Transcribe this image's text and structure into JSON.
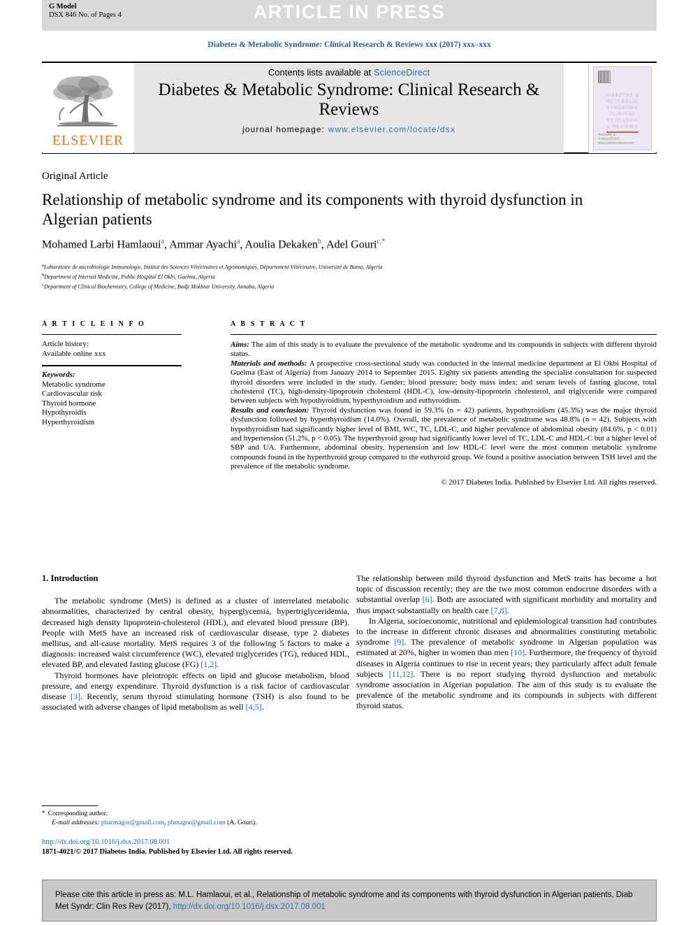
{
  "header": {
    "g_model": "G Model",
    "doc_id": "DSX 846 No. of Pages 4",
    "article_in_press": "ARTICLE IN PRESS",
    "journal_ref": "Diabetes & Metabolic Syndrome: Clinical Research & Reviews xxx (2017) xxx–xxx"
  },
  "masthead": {
    "contents_prefix": "Contents lists available at ",
    "sciencedirect": "ScienceDirect",
    "journal_title": "Diabetes & Metabolic Syndrome: Clinical Research & Reviews",
    "homepage_label": "journal homepage: ",
    "homepage_url": "www.elsevier.com/locate/dsx",
    "publisher": "ELSEVIER",
    "cover_line1": "DIABETES &",
    "cover_line2": "METABOLIC",
    "cover_line3": "SYNDROME",
    "cover_line4": "CLINICAL",
    "cover_line5": "RESEARCH",
    "cover_line6": "& REVIEWS",
    "cover_foot1": "Available at",
    "cover_foot2": "ScienceDirect",
    "cover_foot3": "www.sciencedirect.com"
  },
  "article": {
    "section_type": "Original Article",
    "title": "Relationship of metabolic syndrome and its components with thyroid dysfunction in Algerian patients",
    "authors": [
      {
        "name": "Mohamed Larbi Hamlaoui",
        "sup": "a",
        "sep": ", "
      },
      {
        "name": "Ammar Ayachi",
        "sup": "a",
        "sep": ", "
      },
      {
        "name": "Aoulia Dekaken",
        "sup": "b",
        "sep": ", "
      },
      {
        "name": "Adel Gouri",
        "sup": "c,*",
        "sep": ""
      }
    ],
    "affiliations": [
      {
        "marker": "a",
        "text": "Laboratoire de microbiologie Immunologie, Institut des Sciences Vétérinaires et Agronomiques, Département Vétérinaire, Université de Batna, Algeria"
      },
      {
        "marker": "b",
        "text": "Department of Internal Medicine, Public Hospital El Okbi, Guelma, Algeria"
      },
      {
        "marker": "c",
        "text": "Department of Clinical Biochemistry, College of Medicine, Badji Mokhtar University, Annaba, Algeria"
      }
    ]
  },
  "article_info": {
    "label": "A R T I C L E   I N F O",
    "history_head": "Article history:",
    "history_line": "Available online xxx",
    "keywords_head": "Keywords:",
    "keywords": [
      "Metabolic syndrome",
      "Cardiovascular risk",
      "Thyroid hormone",
      "Hypothyroidis",
      "Hyperthyroidism"
    ]
  },
  "abstract": {
    "label": "A B S T R A C T",
    "aims_lead": "Aims:",
    "aims_text": " The aim of this study is to evaluate the prevalence of the metabolic syndrome and its compounds in subjects with different thyroid status.",
    "methods_lead": "Materials and methods:",
    "methods_text": " A prospective cross-sectional study was conducted in the internal medicine department at El Okbi Hospital of Guelma (East of Algeria) from January 2014 to September 2015. Eighty six patients attending the specialist consultation for suspected thyroid disorders were included in the study. Gender; blood pressure; body mass index; and serum levels of fasting glucose, total cholesterol (TC), high-density-lipoprotein cholesterol (HDL-C), low-density-lipoprotein cholesterol, and triglyceride were compared between subjects with hypothyroidism, hyperthyroidism and euthyroidism.",
    "results_lead": "Results and conclusion:",
    "results_text": " Thyroid dysfunction was found in 59.3% (n = 42) patients, hypothyroidism (45.3%) was the major thyroid dysfunction followed by hyperthyroidism (14.0%). Overall, the prevalence of metabolic syndrome was 48.8% (n = 42). Subjects with hypothyroidism had significantly higher level of BMI, WC, TC, LDL-C, and higher prevalence of abdominal obesity (84.6%, p < 0.01) and hypertension (51.2%, p < 0.05). The hyperthyroid group had significantly lower level of TC, LDL-C and HDL-C but a higher level of SBP and UA. Furthermore, abdominal obesity, hypertension and low HDL-C level were the most common metabolic syndrome compounds found in the hyperthyroid group compared to the euthyroid group. We found a positive association between TSH level and the prevalence of the metabolic syndrome.",
    "copyright": "© 2017 Diabetes India. Published by Elsevier Ltd. All rights reserved."
  },
  "introduction": {
    "heading": "1. Introduction",
    "left_paragraphs": [
      "The metabolic syndrome (MetS) is defined as a cluster of interrelated metabolic abnormalities, characterized by central obesity, hyperglycemia, hypertriglyceridemia, decreased high density lipoprotein-cholesterol (HDL), and elevated blood pressure (BP). People with MetS have an increased risk of cardiovascular disease, type 2 diabetes mellitus, and all-cause mortality. MetS requires 3 of the following 5 factors to make a diagnosis: increased waist circumference (WC), elevated triglycerides (TG), reduced HDL, elevated BP, and elevated fasting glucose (FG) [1,2].",
      "Thyroid hormones have pleiotropic effects on lipid and glucose metabolism, blood pressure, and energy expenditure. Thyroid dysfunction is a risk factor of cardiovascular disease [3]. Recently, serum thyroid stimulating hormone (TSH) is also found to be associated with adverse changes of lipid metabolism as well [4,5]."
    ],
    "right_paragraphs": [
      "The relationship between mild thyroid dysfunction and MetS traits has become a hot topic of discussion recently; they are the two most common endocrine disorders with a substantial overlap [6]. Both are associated with significant morbidity and mortality and thus impact substantially on health care [7,8].",
      "In Algeria, socioeconomic, nutritional and epidemiological transition had contributes to the increase in different chronic diseases and abnormalities constituting metabolic syndrome [9]. The prevalence of metabolic syndrome in Algerian population was estimated at 20%, higher in women than men [10]. Furthermore, the frequency of thyroid diseases in Algeria continues to rise in recent years; they particularly affect adult female subjects [11,12]. There is no report studying thyroid dysfunction and metabolic syndrome association in Algerian population. The aim of this study is to evaluate the prevalence of the metabolic syndrome and its compounds in subjects with different thyroid status."
    ]
  },
  "footnotes": {
    "corresponding": "Corresponding author.",
    "email_label": "E-mail addresses:",
    "email1": "pharmagor@gmail.com",
    "email2": "phmagor@gmail.com",
    "email_owner": "(A. Gouri).",
    "doi_url": "http://dx.doi.org/10.1016/j.dsx.2017.08.001",
    "issn_line": "1871-4021/© 2017 Diabetes India. Published by Elsevier Ltd. All rights reserved."
  },
  "cite_box": {
    "text": "Please cite this article in press as: M.L. Hamlaoui, et al., Relationship of metabolic syndrome and its components with thyroid dysfunction in Algerian patients, Diab Met Syndr: Clin Res Rev (2017), ",
    "link": "http://dx.doi.org/10.1016/j.dsx.2017.08.001"
  },
  "colors": {
    "link_blue": "#1a6ca8",
    "elsevier_orange": "#e87722",
    "bar_grey": "#d9d9d9",
    "cite_grey": "#c9c9c9"
  }
}
